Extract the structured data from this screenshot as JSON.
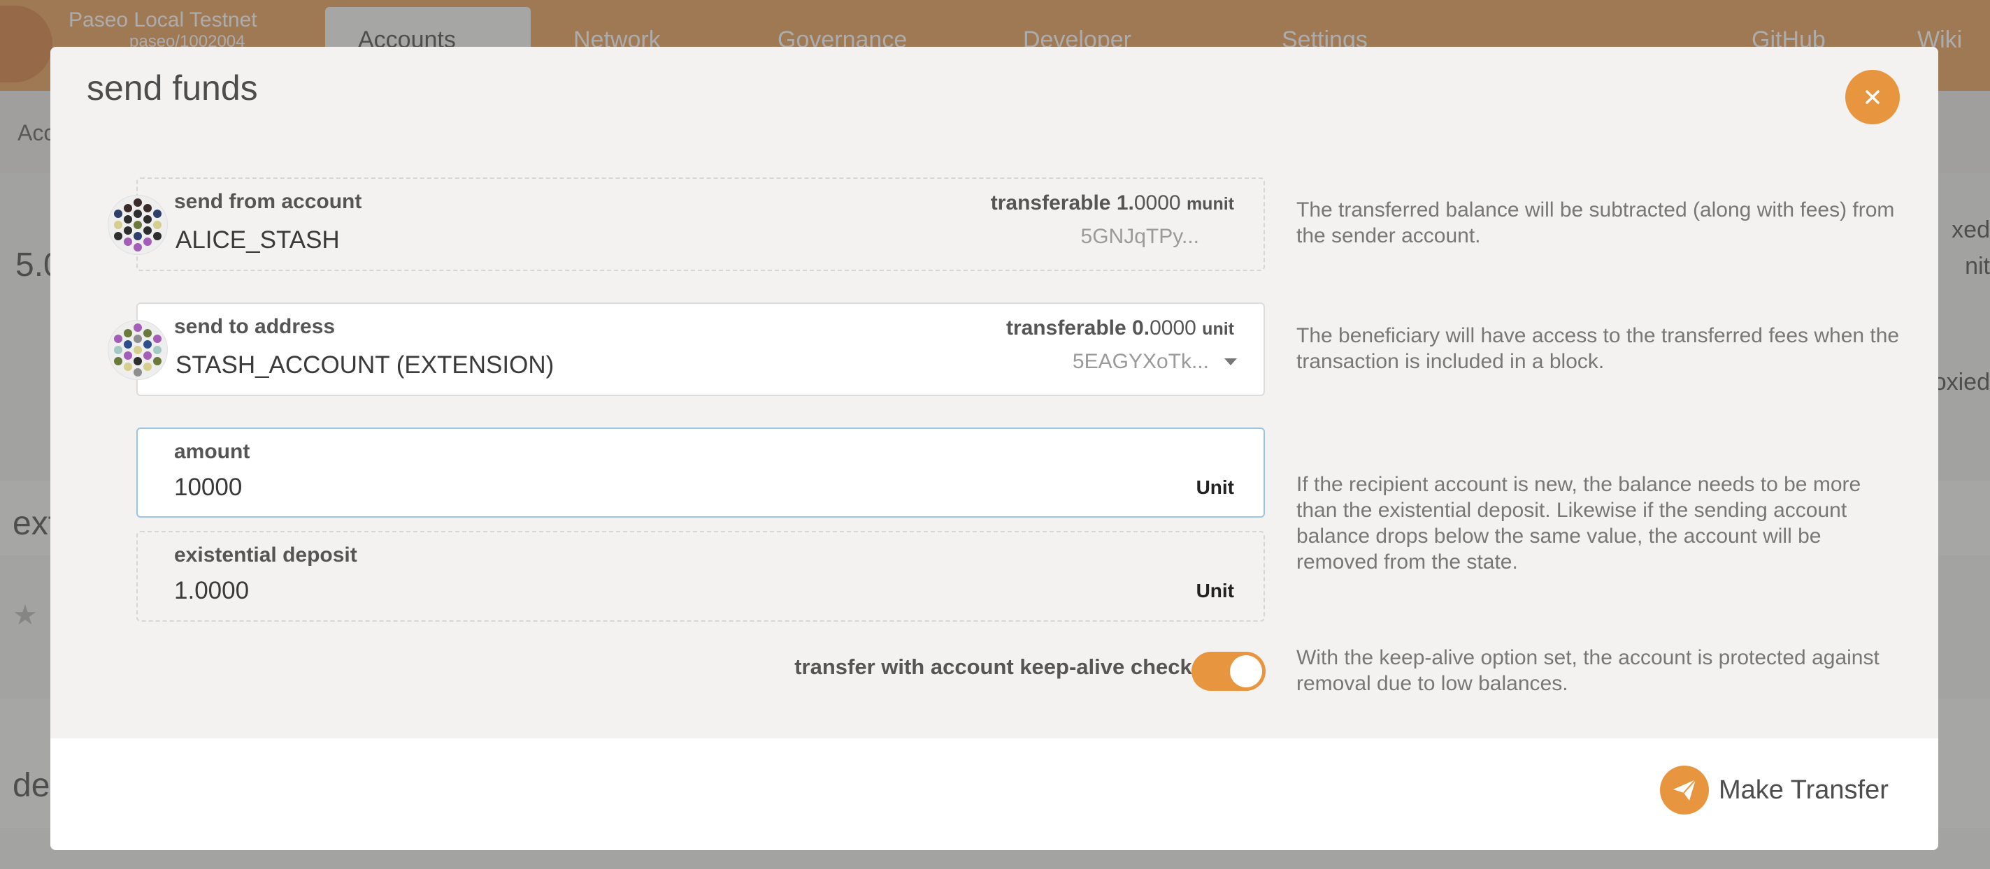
{
  "app": {
    "chain_name": "Paseo Local Testnet",
    "chain_version": "paseo/1002004",
    "nav": [
      "Accounts",
      "Network",
      "Governance",
      "Developer",
      "Settings",
      "GitHub",
      "Wiki"
    ],
    "subnav_fragment": "Acc",
    "bg_number_fragment": "5.0",
    "bg_right_1": "xed",
    "bg_right_2": "nit",
    "bg_right_3": "oxied",
    "bg_section_1": "ext",
    "bg_section_2": "de"
  },
  "modal": {
    "title": "send funds",
    "from": {
      "label": "send from account",
      "account_name": "ALICE_STASH",
      "transferable_label": "transferable",
      "transferable_int": "1.",
      "transferable_dec": "0000",
      "transferable_unit": "munit",
      "address": "5GNJqTPy..."
    },
    "to": {
      "label": "send to address",
      "account_name": "STASH_ACCOUNT (EXTENSION)",
      "transferable_label": "transferable",
      "transferable_int": "0.",
      "transferable_dec": "0000",
      "transferable_unit": "unit",
      "address": "5EAGYXoTk..."
    },
    "amount": {
      "label": "amount",
      "value": "10000",
      "unit": "Unit"
    },
    "existential": {
      "label": "existential deposit",
      "value": "1.0000",
      "unit": "Unit"
    },
    "keep_alive": {
      "label": "transfer with account keep-alive checks",
      "enabled": true
    },
    "help": {
      "from": "The transferred balance will be subtracted (along with fees) from the sender account.",
      "to": "The beneficiary will have access to the transferred fees when the transaction is included in a block.",
      "amount": "If the recipient account is new, the balance needs to be more than the existential deposit. Likewise if the sending account balance drops below the same value, the account will be removed from the state.",
      "keep_alive": "With the keep-alive option set, the account is protected against removal due to low balances."
    },
    "submit_label": "Make Transfer"
  },
  "colors": {
    "accent": "#e8953f",
    "header": "#e8a160",
    "focus_border": "#9cc3e8"
  }
}
